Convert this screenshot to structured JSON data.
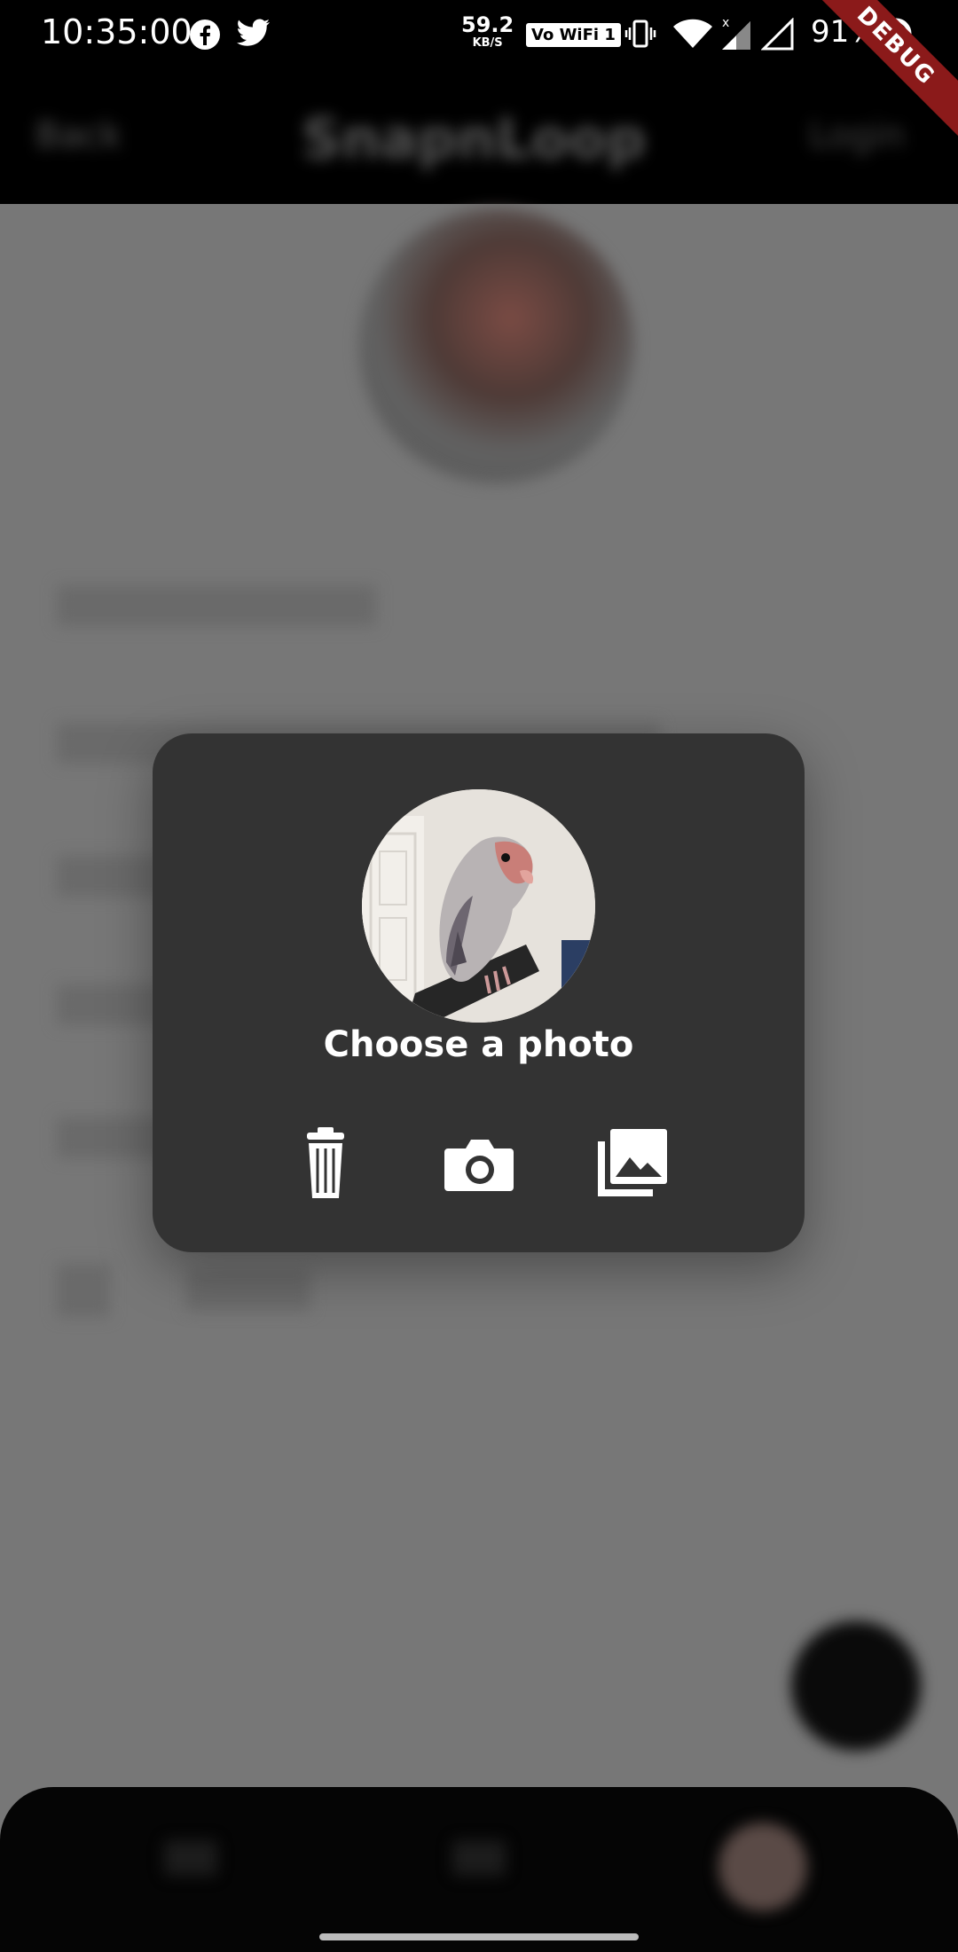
{
  "status_bar": {
    "time": "10:35:00",
    "network_speed": "59.2",
    "network_unit": "KB/S",
    "vowifi": "Vo WiFi 1",
    "battery": "91%",
    "icons": [
      "facebook-icon",
      "twitter-icon",
      "vibrate-icon",
      "wifi-icon",
      "signal-icon",
      "signal-empty-icon",
      "sync-icon"
    ]
  },
  "debug_banner": "DEBUG",
  "background": {
    "app_title": "SnapnLoop",
    "left_action": "Back",
    "right_action": "Login"
  },
  "dialog": {
    "title": "Choose a photo",
    "actions": [
      {
        "name": "delete",
        "icon": "trash-icon"
      },
      {
        "name": "camera",
        "icon": "camera-icon"
      },
      {
        "name": "gallery",
        "icon": "gallery-icon"
      }
    ]
  },
  "colors": {
    "dialog_bg": "#333333",
    "scrim": "#777777",
    "debug": "#8b1a1a"
  }
}
